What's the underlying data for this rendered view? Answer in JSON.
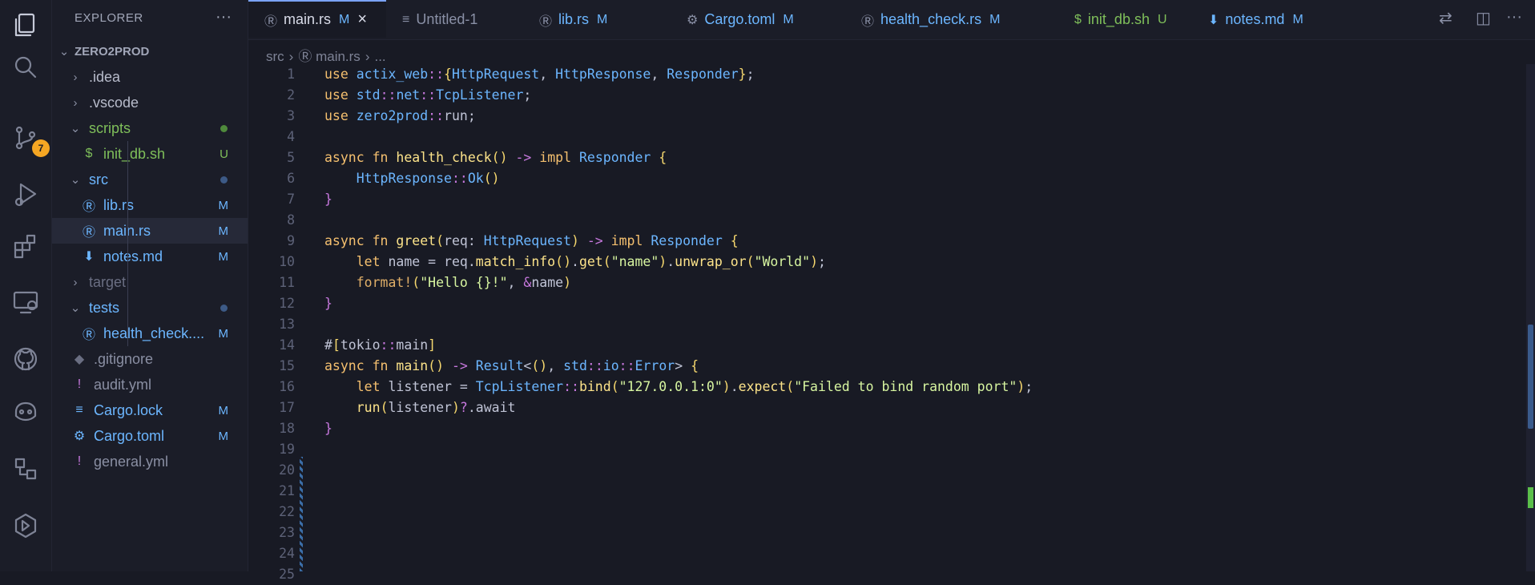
{
  "activity_bar": {
    "items": [
      "files-icon",
      "search-icon",
      "source-control-icon",
      "run-debug-icon",
      "extensions-icon",
      "remote-explorer-icon",
      "github-icon",
      "copilot-icon",
      "ports-icon",
      "ai-assistant-icon"
    ],
    "source_control_badge": "7"
  },
  "sidebar": {
    "title": "EXPLORER",
    "more": "···",
    "project": "ZERO2PROD",
    "tree": [
      {
        "label": ".idea",
        "type": "folder",
        "expanded": false
      },
      {
        "label": ".vscode",
        "type": "folder",
        "expanded": false
      },
      {
        "label": "scripts",
        "type": "folder",
        "expanded": true,
        "color": "#7fbf5a"
      },
      {
        "label": "init_db.sh",
        "type": "file",
        "icon": "$",
        "indicator": "U",
        "color": "#7fbf5a"
      },
      {
        "label": "src",
        "type": "folder",
        "expanded": true,
        "color": "#6cb6ff"
      },
      {
        "label": "lib.rs",
        "type": "file",
        "icon": "rust",
        "indicator": "M",
        "color": "#6cb6ff"
      },
      {
        "label": "main.rs",
        "type": "file",
        "icon": "rust",
        "indicator": "M",
        "color": "#6cb6ff",
        "selected": true
      },
      {
        "label": "notes.md",
        "type": "file",
        "icon": "md",
        "indicator": "M",
        "color": "#6cb6ff"
      },
      {
        "label": "target",
        "type": "folder",
        "expanded": false,
        "color": "#6a6e82"
      },
      {
        "label": "tests",
        "type": "folder",
        "expanded": true,
        "color": "#6cb6ff"
      },
      {
        "label": "health_check....",
        "type": "file",
        "icon": "rust",
        "indicator": "M",
        "color": "#6cb6ff"
      },
      {
        "label": ".gitignore",
        "type": "file",
        "icon": "git",
        "color": "#8a8fa3"
      },
      {
        "label": "audit.yml",
        "type": "file",
        "icon": "!",
        "color": "#8a8fa3"
      },
      {
        "label": "Cargo.lock",
        "type": "file",
        "icon": "lines",
        "indicator": "M",
        "color": "#6cb6ff"
      },
      {
        "label": "Cargo.toml",
        "type": "file",
        "icon": "gear",
        "indicator": "M",
        "color": "#6cb6ff"
      },
      {
        "label": "general.yml",
        "type": "file",
        "icon": "!",
        "color": "#8a8fa3"
      }
    ]
  },
  "tabs": [
    {
      "label": "main.rs",
      "icon": "rust",
      "mark": "M",
      "active": true
    },
    {
      "label": "Untitled-1",
      "icon": "lines"
    },
    {
      "label": "lib.rs",
      "icon": "rust",
      "mark": "M"
    },
    {
      "label": "Cargo.toml",
      "icon": "gear",
      "mark": "M"
    },
    {
      "label": "health_check.rs",
      "icon": "rust",
      "mark": "M"
    },
    {
      "label": "init_db.sh",
      "icon": "$",
      "mark": "U"
    },
    {
      "label": "notes.md",
      "icon": "md",
      "mark": "M"
    }
  ],
  "breadcrumb": {
    "folder": "src",
    "file": "main.rs",
    "symbol": "..."
  },
  "editor": {
    "lines": [
      "use actix_web::{HttpRequest, HttpResponse, Responder};",
      "use std::net::TcpListener;",
      "use zero2prod::run;",
      "",
      "async fn health_check() -> impl Responder {",
      "    HttpResponse::Ok()",
      "}",
      "",
      "async fn greet(req: HttpRequest) -> impl Responder {",
      "    let name = req.match_info().get(\"name\").unwrap_or(\"World\");",
      "    format!(\"Hello {}!\", &name)",
      "}",
      "",
      "#[tokio::main]",
      "async fn main() -> Result<(), std::io::Error> {",
      "    let listener = TcpListener::bind(\"127.0.0.1:0\").expect(\"Failed to bind random port\");",
      "    run(listener)?.await",
      "}",
      "",
      "",
      "",
      "",
      "",
      "",
      ""
    ]
  }
}
